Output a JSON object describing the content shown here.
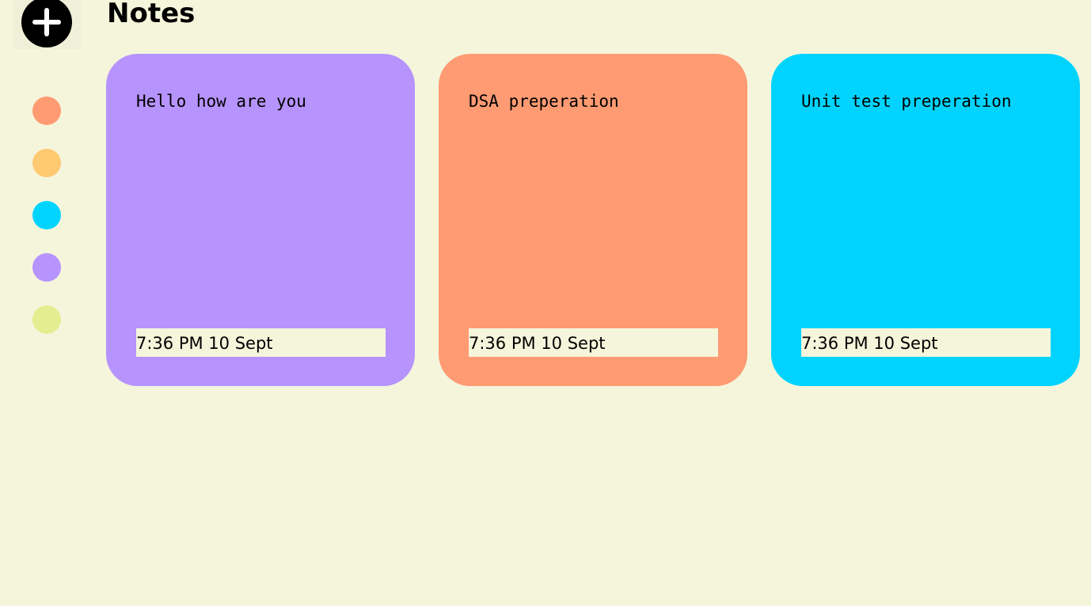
{
  "header": {
    "title": "Notes"
  },
  "sidebar": {
    "add_icon": "plus-circle-icon",
    "colors": [
      "#fe9b72",
      "#fec971",
      "#00d4fe",
      "#b693fd",
      "#e4ee91"
    ]
  },
  "notes": [
    {
      "text": "Hello how are you",
      "time": "7:36 PM 10 Sept",
      "color": "#b693fd"
    },
    {
      "text": "DSA preperation",
      "time": "7:36 PM 10 Sept",
      "color": "#fe9b72"
    },
    {
      "text": "Unit test preperation",
      "time": "7:36 PM 10 Sept",
      "color": "#00d4fe"
    }
  ]
}
